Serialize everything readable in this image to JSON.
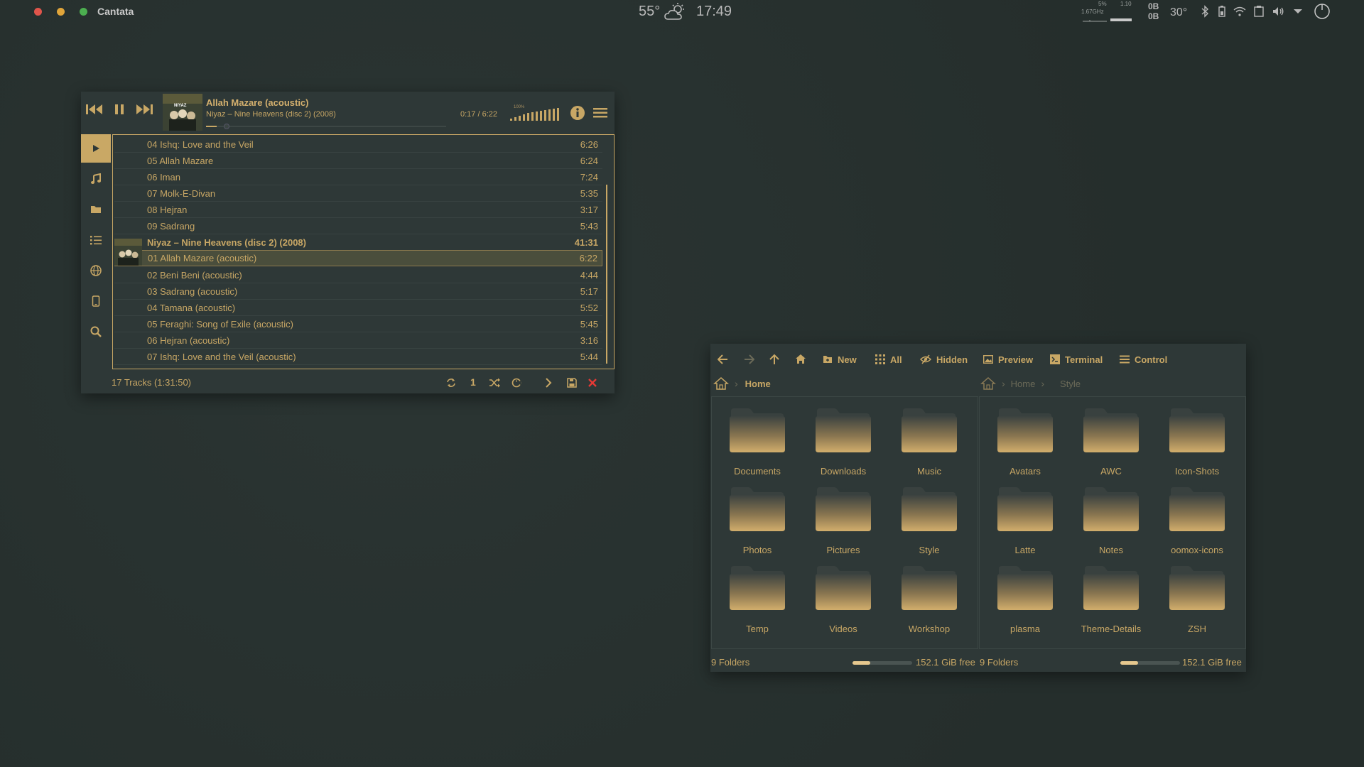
{
  "topbar": {
    "app_title": "Cantata",
    "weather_temp": "55°",
    "clock": "17:49",
    "cpu_percent": "5%",
    "cpu_freq": "1.67GHz",
    "load": "1.10",
    "net_up": "0B",
    "net_down": "0B",
    "cpu_temp": "30°",
    "colors": {
      "close": "#e0554b",
      "minimize": "#e0a53a",
      "maximize": "#4caf50"
    }
  },
  "cantata": {
    "now_playing": {
      "title": "Allah Mazare (acoustic)",
      "subtitle": "Niyaz – Nine Heavens (disc 2) (2008)",
      "time": "0:17 / 6:22",
      "progress": 0.045,
      "volume_label": "100%"
    },
    "sidebar": [
      "play-queue",
      "library",
      "folders",
      "playlists",
      "internet",
      "devices",
      "search"
    ],
    "tracks": [
      {
        "title": "04 Ishq: Love and the Veil",
        "duration": "6:26"
      },
      {
        "title": "05 Allah Mazare",
        "duration": "6:24"
      },
      {
        "title": "06 Iman",
        "duration": "7:24"
      },
      {
        "title": "07 Molk-E-Divan",
        "duration": "5:35"
      },
      {
        "title": "08 Hejran",
        "duration": "3:17"
      },
      {
        "title": "09 Sadrang",
        "duration": "5:43"
      }
    ],
    "album_header": {
      "title": "Niyaz – Nine Heavens (disc 2) (2008)",
      "duration": "41:31"
    },
    "album_tracks": [
      {
        "title": "01 Allah Mazare (acoustic)",
        "duration": "6:22"
      },
      {
        "title": "02 Beni Beni (acoustic)",
        "duration": "4:44"
      },
      {
        "title": "03 Sadrang (acoustic)",
        "duration": "5:17"
      },
      {
        "title": "04 Tamana (acoustic)",
        "duration": "5:52"
      },
      {
        "title": "05 Feraghi: Song of Exile (acoustic)",
        "duration": "5:45"
      },
      {
        "title": "06 Hejran (acoustic)",
        "duration": "3:16"
      },
      {
        "title": "07 Ishq: Love and the Veil (acoustic)",
        "duration": "5:44"
      }
    ],
    "status": "17 Tracks (1:31:50)",
    "single_label": "1",
    "cover_text": "NIYAZ"
  },
  "dolphin": {
    "toolbar": {
      "new": "New",
      "all": "All",
      "hidden": "Hidden",
      "preview": "Preview",
      "terminal": "Terminal",
      "control": "Control"
    },
    "left": {
      "breadcrumb": [
        "Home"
      ],
      "folders": [
        "Documents",
        "Downloads",
        "Music",
        "Photos",
        "Pictures",
        "Style",
        "Temp",
        "Videos",
        "Workshop"
      ],
      "status": "9 Folders",
      "free": "152.1 GiB free",
      "usage": 0.3
    },
    "right": {
      "breadcrumb": [
        "Home",
        "Style"
      ],
      "folders": [
        "Avatars",
        "AWC",
        "Icon-Shots",
        "Latte",
        "Notes",
        "oomox-icons",
        "plasma",
        "Theme-Details",
        "ZSH"
      ],
      "status": "9 Folders",
      "free": "152.1 GiB free",
      "usage": 0.3
    }
  }
}
